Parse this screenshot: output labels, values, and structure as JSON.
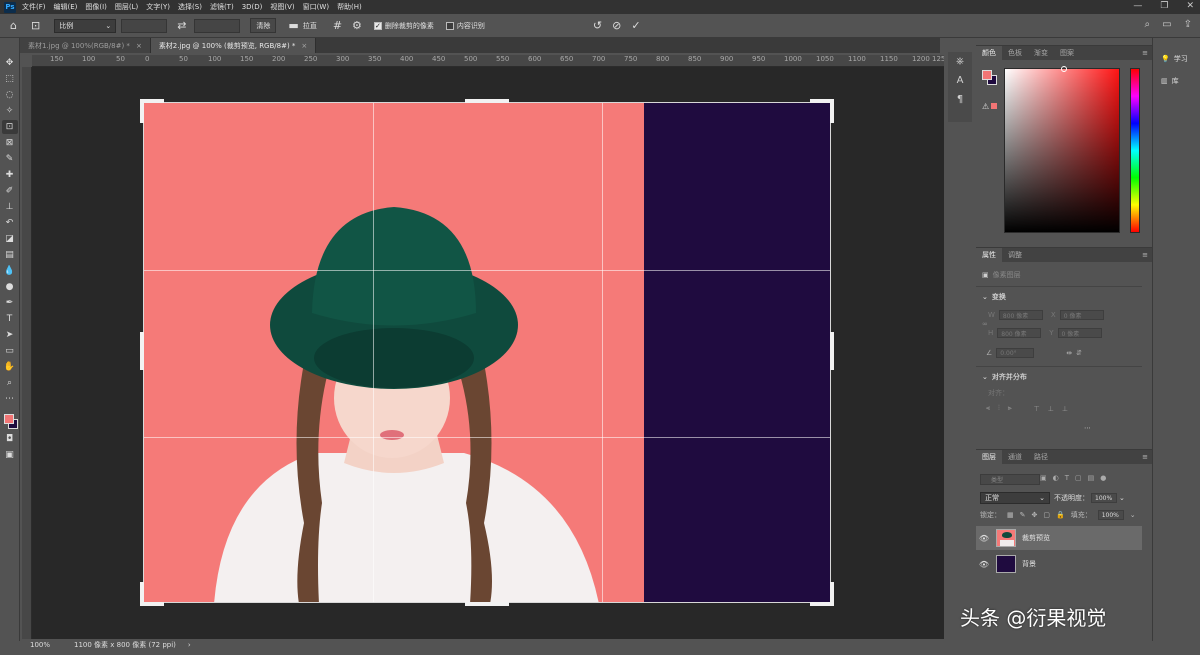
{
  "menubar": {
    "logo": "Ps",
    "items": [
      "文件(F)",
      "编辑(E)",
      "图像(I)",
      "图层(L)",
      "文字(Y)",
      "选择(S)",
      "滤镜(T)",
      "3D(D)",
      "视图(V)",
      "窗口(W)",
      "帮助(H)"
    ],
    "controls": [
      "—",
      "❐",
      "✕"
    ]
  },
  "options": {
    "ratio_select": "比例",
    "clear_button": "清除",
    "straighten_label": "拉直",
    "delete_cropped_label": "删除裁剪的像素",
    "delete_cropped_checked": true,
    "content_aware_label": "内容识别",
    "content_aware_checked": false
  },
  "tabs": [
    {
      "label": "素材1.jpg @ 100%(RGB/8#) *",
      "active": false
    },
    {
      "label": "素材2.jpg @ 100% (裁剪预览, RGB/8#) *",
      "active": true
    }
  ],
  "ruler": {
    "labels": [
      "150",
      "100",
      "50",
      "0",
      "50",
      "100",
      "150",
      "200",
      "250",
      "300",
      "350",
      "400",
      "450",
      "500",
      "550",
      "600",
      "650",
      "700",
      "750",
      "800",
      "850",
      "900",
      "950",
      "1000",
      "1050",
      "1100",
      "1150",
      "1200",
      "125"
    ]
  },
  "status": {
    "zoom": "100%",
    "doc_info": "1100 像素 x 800 像素 (72 ppi)"
  },
  "far_right": {
    "learn": "学习",
    "library": "库"
  },
  "color_panel": {
    "tabs": [
      "颜色",
      "色板",
      "渐变",
      "图案"
    ],
    "fg_color": "#f27575",
    "bg_color": "#1f0b3f"
  },
  "properties_panel": {
    "tabs": [
      "属性",
      "调整"
    ],
    "layer_type": "像素图层",
    "transform_title": "变换",
    "w_label": "W",
    "w_value": "800 像素",
    "x_label": "X",
    "x_value": "0 像素",
    "h_label": "H",
    "h_value": "800 像素",
    "y_label": "Y",
    "y_value": "0 像素",
    "angle_value": "0.00°",
    "align_title": "对齐并分布",
    "align_sub": "对齐："
  },
  "layers_panel": {
    "tabs": [
      "图层",
      "通道",
      "路径"
    ],
    "search_placeholder": "类型",
    "blend_mode": "正常",
    "opacity_label": "不透明度：",
    "opacity_value": "100%",
    "lock_label": "锁定：",
    "fill_label": "填充：",
    "fill_value": "100%",
    "layers": [
      {
        "name": "裁剪预览",
        "selected": true
      },
      {
        "name": "背景",
        "selected": false
      }
    ]
  },
  "watermark": "头条 @衍果视觉"
}
